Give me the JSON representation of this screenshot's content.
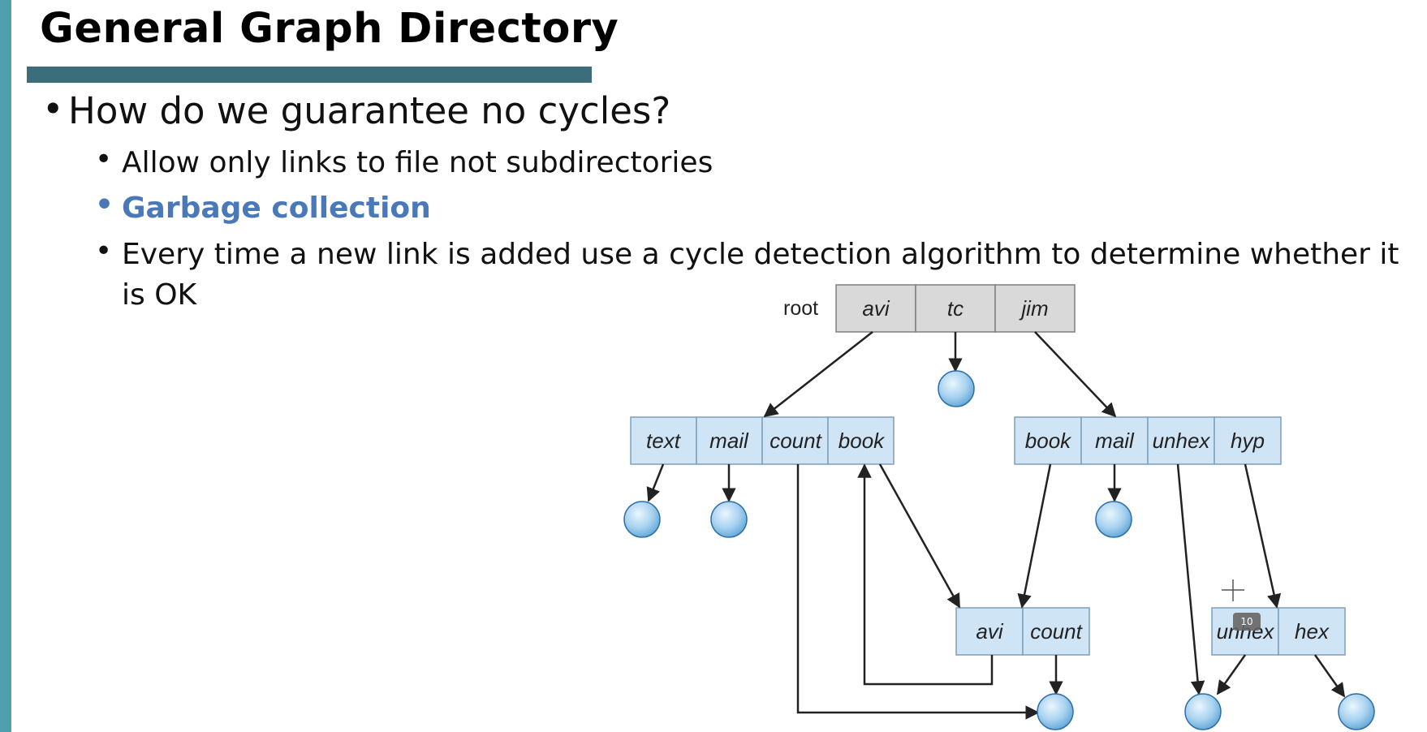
{
  "slide": {
    "title": "General Graph Directory",
    "bullet_glyph": "•",
    "question": "How do we guarantee no cycles?",
    "points": [
      "Allow only links to file not subdirectories",
      "Garbage collection",
      "Every time a new link is added use a cycle detection algorithm to determine whether it"
    ],
    "point3_continuation": "is OK",
    "slide_badge": "10",
    "colors": {
      "accent_bar": "#4f9fad",
      "title_rule": "#3b6d7a",
      "highlight": "#4a78b9",
      "gray_cell": "#d9d9d9",
      "blue_cell": "#cfe4f5"
    }
  },
  "diagram": {
    "root_label": "root",
    "dirs": [
      {
        "id": "root",
        "cells": [
          "avi",
          "tc",
          "jim"
        ]
      },
      {
        "id": "avi_dir",
        "cells": [
          "text",
          "mail",
          "count",
          "book"
        ]
      },
      {
        "id": "jim_dir",
        "cells": [
          "book",
          "mail",
          "unhex",
          "hyp"
        ]
      },
      {
        "id": "shared_dir",
        "cells": [
          "avi",
          "count"
        ]
      },
      {
        "id": "hyp_dir",
        "cells": [
          "unhex",
          "hex"
        ]
      }
    ]
  }
}
